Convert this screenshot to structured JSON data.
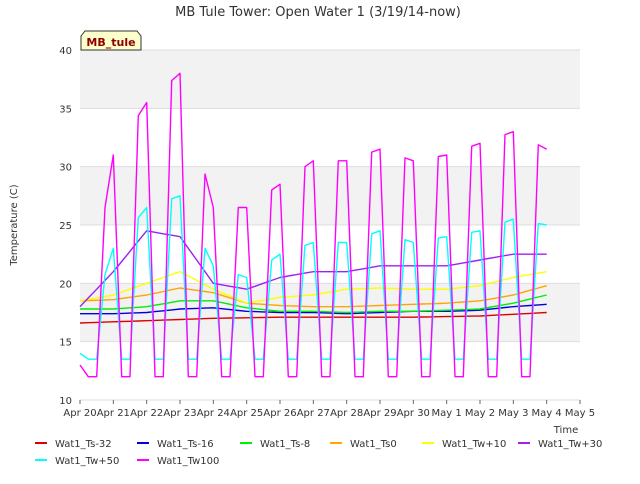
{
  "chart_data": {
    "type": "line",
    "title": "MB Tule Tower: Open Water 1 (3/19/14-now)",
    "xlabel": "Time",
    "ylabel": "Temperature (C)",
    "ylim": [
      10,
      40
    ],
    "y_ticks": [
      10,
      15,
      20,
      25,
      30,
      35,
      40
    ],
    "xlim_days": [
      "Apr 20",
      "May 5"
    ],
    "x_tick_labels": [
      "Apr 20",
      "Apr 21",
      "Apr 22",
      "Apr 23",
      "Apr 24",
      "Apr 25",
      "Apr 26",
      "Apr 27",
      "Apr 28",
      "Apr 29",
      "Apr 30",
      "May 1",
      "May 2",
      "May 3",
      "May 4",
      "May 5"
    ],
    "grid": true,
    "background_bands": "alternating light gray horizontal bands",
    "legend_position": "bottom",
    "site_label": "MB_tule",
    "series": [
      {
        "name": "Wat1_Ts-32",
        "color": "#dd0000",
        "x": [
          "Apr 20",
          "Apr 22",
          "Apr 24",
          "Apr 26",
          "Apr 28",
          "Apr 30",
          "May 2",
          "May 4"
        ],
        "values": [
          16.6,
          16.8,
          17.0,
          17.1,
          17.1,
          17.1,
          17.2,
          17.5
        ]
      },
      {
        "name": "Wat1_Ts-16",
        "color": "#0000dd",
        "x": [
          "Apr 20",
          "Apr 21",
          "Apr 22",
          "Apr 23",
          "Apr 24",
          "Apr 25",
          "Apr 26",
          "Apr 27",
          "Apr 28",
          "Apr 29",
          "Apr 30",
          "May 1",
          "May 2",
          "May 3",
          "May 4"
        ],
        "values": [
          17.4,
          17.4,
          17.5,
          17.8,
          17.9,
          17.6,
          17.5,
          17.5,
          17.4,
          17.5,
          17.6,
          17.6,
          17.7,
          18.0,
          18.2
        ]
      },
      {
        "name": "Wat1_Ts-8",
        "color": "#00ee00",
        "x": [
          "Apr 20",
          "Apr 21",
          "Apr 22",
          "Apr 23",
          "Apr 24",
          "Apr 25",
          "Apr 26",
          "Apr 27",
          "Apr 28",
          "Apr 29",
          "Apr 30",
          "May 1",
          "May 2",
          "May 3",
          "May 4"
        ],
        "values": [
          17.8,
          17.8,
          18.0,
          18.5,
          18.5,
          17.9,
          17.6,
          17.6,
          17.5,
          17.6,
          17.6,
          17.7,
          17.8,
          18.3,
          19.0
        ]
      },
      {
        "name": "Wat1_Ts0",
        "color": "#ffa500",
        "x": [
          "Apr 20",
          "Apr 21",
          "Apr 22",
          "Apr 23",
          "Apr 24",
          "Apr 25",
          "Apr 26",
          "Apr 27",
          "Apr 28",
          "Apr 29",
          "Apr 30",
          "May 1",
          "May 2",
          "May 3",
          "May 4"
        ],
        "values": [
          18.5,
          18.6,
          19.0,
          19.6,
          19.2,
          18.3,
          18.1,
          18.0,
          18.0,
          18.1,
          18.2,
          18.3,
          18.5,
          19.0,
          19.8
        ]
      },
      {
        "name": "Wat1_Tw+10",
        "color": "#ffff00",
        "x": [
          "Apr 20",
          "Apr 21",
          "Apr 22",
          "Apr 23",
          "Apr 24",
          "Apr 25",
          "Apr 26",
          "Apr 27",
          "Apr 28",
          "Apr 29",
          "Apr 30",
          "May 1",
          "May 2",
          "May 3",
          "May 4"
        ],
        "values": [
          18.5,
          19.0,
          20.0,
          21.0,
          19.5,
          18.3,
          18.8,
          19.0,
          19.5,
          19.6,
          19.5,
          19.5,
          19.8,
          20.5,
          21.0
        ]
      },
      {
        "name": "Wat1_Tw+30",
        "color": "#a020f0",
        "x": [
          "Apr 20",
          "Apr 21",
          "Apr 22",
          "Apr 23",
          "Apr 24",
          "Apr 25",
          "Apr 26",
          "Apr 27",
          "Apr 28",
          "Apr 29",
          "Apr 30",
          "May 1",
          "May 2",
          "May 3",
          "May 4"
        ],
        "values": [
          18.0,
          21.0,
          24.5,
          24.0,
          20.0,
          19.5,
          20.5,
          21.0,
          21.0,
          21.5,
          21.5,
          21.5,
          22.0,
          22.5,
          22.5
        ]
      },
      {
        "name": "Wat1_Tw+50",
        "color": "#00ffff",
        "x": [
          "Apr 20",
          "Apr 21",
          "Apr 22",
          "Apr 23",
          "Apr 24",
          "Apr 25",
          "Apr 26",
          "Apr 27",
          "Apr 28",
          "Apr 29",
          "Apr 30",
          "May 1",
          "May 2",
          "May 3",
          "May 4"
        ],
        "values": [
          14.0,
          23.0,
          26.5,
          27.5,
          21.5,
          20.5,
          22.5,
          23.5,
          23.5,
          24.5,
          23.5,
          24.0,
          24.5,
          25.5,
          25.0
        ],
        "daily_minimum": 13.5
      },
      {
        "name": "Wat1_Tw100",
        "color": "#ff00ff",
        "x": [
          "Apr 20",
          "Apr 21",
          "Apr 22",
          "Apr 23",
          "Apr 24",
          "Apr 25",
          "Apr 26",
          "Apr 27",
          "Apr 28",
          "Apr 29",
          "Apr 30",
          "May 1",
          "May 2",
          "May 3",
          "May 4"
        ],
        "values": [
          13.0,
          31.0,
          35.5,
          38.0,
          26.5,
          26.5,
          28.5,
          30.5,
          30.5,
          31.5,
          30.5,
          31.0,
          32.0,
          33.0,
          31.5
        ],
        "daily_minimum": 12.0
      }
    ]
  }
}
